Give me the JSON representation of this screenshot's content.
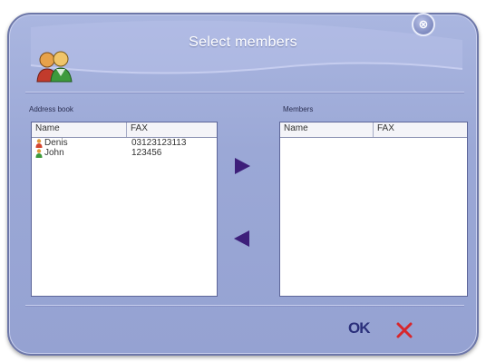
{
  "dialog": {
    "title": "Select members",
    "close_symbol": "⊗"
  },
  "icons": {
    "header": "users-avatar-icon",
    "close": "close-icon",
    "contact": "person-icon",
    "move_right": "arrow-right-icon",
    "move_left": "arrow-left-icon",
    "cancel": "cancel-x-icon"
  },
  "address_book": {
    "label": "Address book",
    "columns": [
      "Name",
      "FAX"
    ],
    "rows": [
      {
        "name": "Denis",
        "fax": "03123123113"
      },
      {
        "name": "John",
        "fax": "123456"
      }
    ]
  },
  "members": {
    "label": "Members",
    "columns": [
      "Name",
      "FAX"
    ],
    "rows": []
  },
  "buttons": {
    "ok_label": "OK"
  },
  "colors": {
    "dialog_bg": "#9ba8d6",
    "arrow": "#3d1f7a",
    "cancel": "#d8262b",
    "ok": "#2a2f7a"
  }
}
